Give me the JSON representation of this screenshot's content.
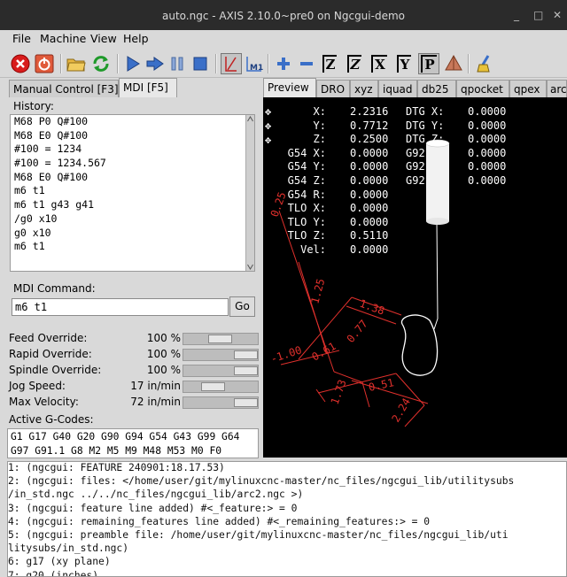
{
  "window": {
    "title": "auto.ngc - AXIS 2.10.0~pre0 on Ngcgui-demo",
    "min_glyph": "_",
    "max_glyph": "□",
    "close_glyph": "✕"
  },
  "menu": [
    "File",
    "Machine",
    "View",
    "Help"
  ],
  "left_tabs": [
    "Manual Control [F3]",
    "MDI [F5]"
  ],
  "right_tabs": [
    "Preview",
    "DRO",
    "xyz",
    "iquad",
    "db25",
    "qpocket",
    "qpex",
    "arc"
  ],
  "history": {
    "label": "History:",
    "lines": [
      "M68 P0 Q#100",
      "M68 E0 Q#100",
      "#100 = 1234",
      "#100 = 1234.567",
      "M68 E0 Q#100",
      "m6 t1",
      "m6 t1 g43 g41",
      "/g0 x10",
      "g0 x10",
      "m6 t1"
    ]
  },
  "mdi": {
    "label": "MDI Command:",
    "value": "m6 t1",
    "go_label": "Go"
  },
  "overrides": [
    {
      "label": "Feed Override:",
      "value": "100 %",
      "level": 0.5
    },
    {
      "label": "Rapid Override:",
      "value": "100 %",
      "level": 1.0
    },
    {
      "label": "Spindle Override:",
      "value": "100 %",
      "level": 1.0
    },
    {
      "label": "Jog Speed:",
      "value": "17 in/min",
      "level": 0.3
    },
    {
      "label": "Max Velocity:",
      "value": "72 in/min",
      "level": 1.0
    }
  ],
  "gcodes": {
    "label": "Active G-Codes:",
    "line1": "G1 G17 G40 G20 G90 G94 G54 G43 G99 G64",
    "line2": "G97 G91.1 G8 M2 M5 M9 M48 M53 M0 F0"
  },
  "dro": {
    "col1": [
      {
        "label": "X:",
        "value": "2.2316"
      },
      {
        "label": "Y:",
        "value": "0.7712"
      },
      {
        "label": "Z:",
        "value": "0.2500"
      },
      {
        "label": "G54 X:",
        "value": "0.0000"
      },
      {
        "label": "G54 Y:",
        "value": "0.0000"
      },
      {
        "label": "G54 Z:",
        "value": "0.0000"
      },
      {
        "label": "G54 R:",
        "value": "0.0000"
      },
      {
        "label": "TLO X:",
        "value": "0.0000"
      },
      {
        "label": "TLO Y:",
        "value": "0.0000"
      },
      {
        "label": "TLO Z:",
        "value": "0.5110"
      },
      {
        "label": "Vel:",
        "value": "0.0000"
      }
    ],
    "col2": [
      {
        "label": "DTG X:",
        "value": "0.0000"
      },
      {
        "label": "DTG Y:",
        "value": "0.0000"
      },
      {
        "label": "DTG Z:",
        "value": "0.0000"
      },
      {
        "label": "G92",
        "value": "0.0000"
      },
      {
        "label": "G92",
        "value": "0.0000"
      },
      {
        "label": "G92",
        "value": "0.0000"
      }
    ],
    "homed_glyph": "✥"
  },
  "preview_labels": [
    "0.25",
    "1.25",
    "1.38",
    "0.77",
    "0.61",
    "-1.00",
    "1.73",
    "0.51",
    "2.24"
  ],
  "output": [
    "     1: (ngcgui: FEATURE 240901:18.17.53)",
    "     2: (ngcgui: files: </home/user/git/mylinuxcnc-master/nc_files/ngcgui_lib/utilitysubs",
    "/in_std.ngc ../../nc_files/ngcgui_lib/arc2.ngc >)",
    "     3: (ngcgui: feature line added) #<_feature:> = 0",
    "     4: (ngcgui: remaining_features line added) #<_remaining_features:> = 0",
    "     5: (ngcgui: preamble file: /home/user/git/mylinuxcnc-master/nc_files/ngcgui_lib/uti",
    "litysubs/in_std.ngc)",
    "     6: g17 (xy plane)",
    "     7: g20 (inches)"
  ],
  "colors": {
    "preview_bg": "#000000",
    "dim_red": "#e0302c",
    "dro_text": "#ffffff"
  }
}
